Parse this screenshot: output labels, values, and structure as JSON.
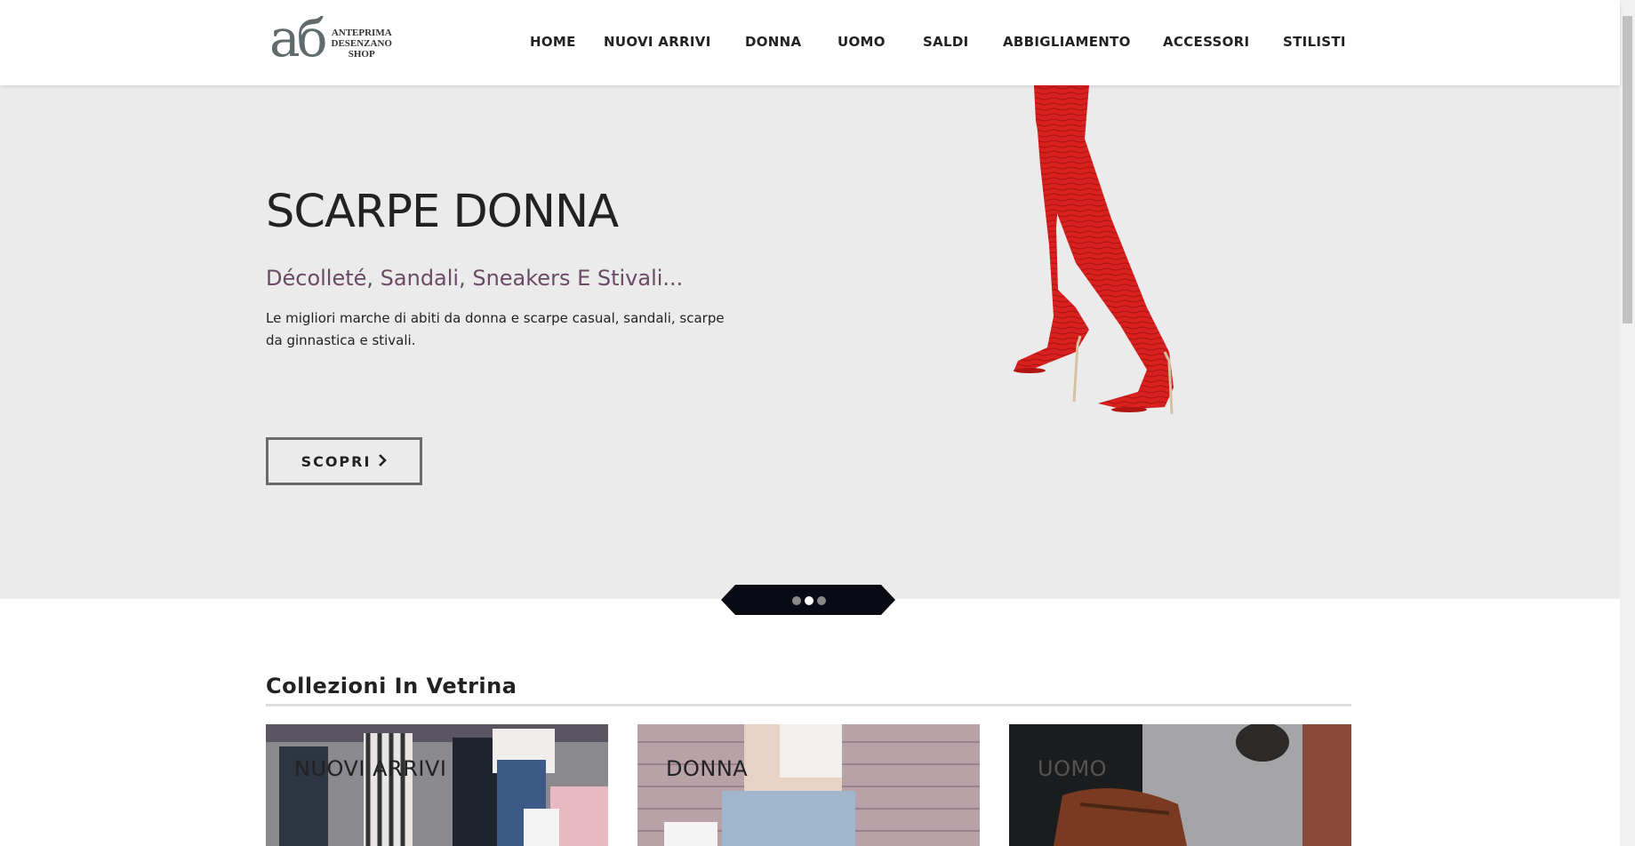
{
  "logo": {
    "mark": "aб",
    "line1": "ANTEPRIMA",
    "line2": "DESENZANO",
    "line3": "SHOP"
  },
  "nav": {
    "items": [
      {
        "label": "HOME"
      },
      {
        "label": "NUOVI ARRIVI"
      },
      {
        "label": "DONNA"
      },
      {
        "label": "UOMO"
      },
      {
        "label": "SALDI"
      },
      {
        "label": "ABBIGLIAMENTO"
      },
      {
        "label": "ACCESSORI"
      },
      {
        "label": "STILISTI"
      }
    ]
  },
  "hero": {
    "title": "SCARPE DONNA",
    "subtitle": "Décolleté, Sandali, Sneakers E Stivali...",
    "description": "Le migliori marche di abiti da donna e scarpe casual, sandali, scarpe da ginnastica e stivali.",
    "button_label": "SCOPRI",
    "button_icon": "chevron-right-icon"
  },
  "carousel": {
    "slide_count": 3,
    "active_index": 1
  },
  "collections": {
    "title": "Collezioni In Vetrina",
    "cards": [
      {
        "label": "NUOVI ARRIVI"
      },
      {
        "label": "DONNA"
      },
      {
        "label": "UOMO"
      }
    ]
  },
  "colors": {
    "hero_bg": "#ebebeb",
    "subtitle": "#6a4a64",
    "boots": "#d8201f",
    "pager": "#0a0a14"
  }
}
